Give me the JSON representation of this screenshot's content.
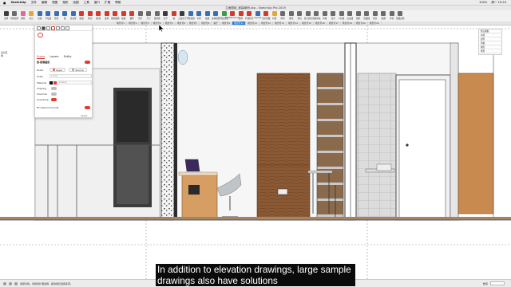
{
  "menubar": {
    "items": [
      "SketchUp",
      "文件",
      "编辑",
      "视图",
      "相机",
      "绘图",
      "工具",
      "窗口",
      "扩展",
      "帮助"
    ],
    "right": [
      "100%",
      "周一 10:24"
    ]
  },
  "window": {
    "title": "立面图纸_家装案例.skp - SketchUp Pro 2019"
  },
  "toolbar": {
    "tools": [
      {
        "label": "选择",
        "color": "#3c3c3c"
      },
      {
        "label": "制作组件",
        "color": "#6b6b6b"
      },
      {
        "label": "擦除",
        "color": "#d96b9a"
      },
      {
        "label": "标记",
        "color": "#e0a93a"
      },
      {
        "label": "直线",
        "color": "#3b6fb4"
      },
      {
        "label": "手绘线",
        "color": "#3b6fb4"
      },
      {
        "label": "矩形",
        "color": "#3b6fb4"
      },
      {
        "label": "圆",
        "color": "#3b6fb4"
      },
      {
        "label": "多边形",
        "color": "#3b6fb4"
      },
      {
        "label": "圆弧",
        "color": "#d23a2c"
      },
      {
        "label": "移动",
        "color": "#d23a2c"
      },
      {
        "label": "推/拉",
        "color": "#d23a2c"
      },
      {
        "label": "旋转",
        "color": "#d23a2c"
      },
      {
        "label": "路径跟随",
        "color": "#d23a2c"
      },
      {
        "label": "缩放",
        "color": "#d23a2c"
      },
      {
        "label": "偏移",
        "color": "#d23a2c"
      },
      {
        "label": "卷尺",
        "color": "#6b6b6b"
      },
      {
        "label": "尺寸",
        "color": "#6b6b6b"
      },
      {
        "label": "量角器",
        "color": "#6b6b6b"
      },
      {
        "label": "文字",
        "color": "#3b3b3b"
      },
      {
        "label": "轴",
        "color": "#d23a2c"
      },
      {
        "label": "三维文字",
        "color": "#3b3b3b"
      },
      {
        "label": "环绕观察",
        "color": "#3b6fb4"
      },
      {
        "label": "平移",
        "color": "#3b6fb4"
      },
      {
        "label": "缩放",
        "color": "#3b6fb4"
      },
      {
        "label": "充满视野",
        "color": "#3b6fb4"
      },
      {
        "label": "添加位置",
        "color": "#3a9c4a"
      },
      {
        "label": "3D Warehouse",
        "color": "#d23a2c"
      },
      {
        "label": "组件",
        "color": "#d23a2c"
      },
      {
        "label": "扩展程序",
        "color": "#d23a2c"
      },
      {
        "label": "LayOut",
        "color": "#3b6fb4"
      },
      {
        "label": "显示隐藏",
        "color": "#d23a2c"
      },
      {
        "label": "材质",
        "color": "#e0a93a"
      },
      {
        "label": "阴影",
        "color": "#6b6b6b"
      },
      {
        "label": "雾化",
        "color": "#6b6b6b"
      },
      {
        "label": "剖切",
        "color": "#6b6b6b"
      },
      {
        "label": "显示剖切",
        "color": "#6b6b6b"
      },
      {
        "label": "剖面填充",
        "color": "#6b6b6b"
      },
      {
        "label": "风格",
        "color": "#6b6b6b"
      },
      {
        "label": "显示",
        "color": "#6b6b6b"
      },
      {
        "label": "X射线",
        "color": "#6b6b6b"
      },
      {
        "label": "后边线",
        "color": "#6b6b6b"
      },
      {
        "label": "线框",
        "color": "#6b6b6b"
      },
      {
        "label": "隐藏线",
        "color": "#6b6b6b"
      },
      {
        "label": "着色",
        "color": "#6b6b6b"
      },
      {
        "label": "贴图",
        "color": "#6b6b6b"
      },
      {
        "label": "单色",
        "color": "#6b6b6b"
      },
      {
        "label": "隐藏其他",
        "color": "#6b6b6b"
      }
    ]
  },
  "tabs": [
    "场景号1",
    "场景号2",
    "场景号3",
    "场景号4",
    "场景号5",
    "场景号6",
    "场景号7",
    "场景号8",
    "客厅",
    "场景号9",
    "场景号10",
    "场景号11",
    "场景号12",
    "场景号13",
    "场景号14",
    "场景号15",
    "场景号16",
    "场景号17",
    "场景号18",
    "场景号19",
    "场景号20"
  ],
  "active_tab_index": 10,
  "left_label": "设计区域",
  "entity_panel": {
    "tabs": [
      "Scene",
      "Layers",
      "Entity"
    ],
    "active_tab": "Scene",
    "title": "剖-影像图纸",
    "rows": {
      "order_label": "Order",
      "order_option1": "Layer",
      "order_option2": "Source",
      "scale_label": "Scale",
      "scale_value": "1:100",
      "material_label": "Material",
      "material_value": "Default",
      "clipping_label": "Clipping",
      "override_label": "Override",
      "linestyle_label": "Line/deep",
      "fit_label": "Fit view to bounds"
    },
    "apply": "Apply"
  },
  "right_panel": {
    "items": [
      "默认面板",
      "材质",
      "组件",
      "风格",
      "图层",
      "场景"
    ]
  },
  "status": {
    "hint": "选择对象。切换到扩展选择。拖动鼠标选择多项。",
    "measure_label": "数值"
  },
  "subtitle": {
    "line1": "In addition to elevation drawings, large sample",
    "line2": "drawings also have solutions"
  },
  "colors": {
    "accent": "#2a79d8",
    "brand_red": "#e23b2e",
    "wood": "#8a5a35",
    "door": "#f2f2f2"
  }
}
